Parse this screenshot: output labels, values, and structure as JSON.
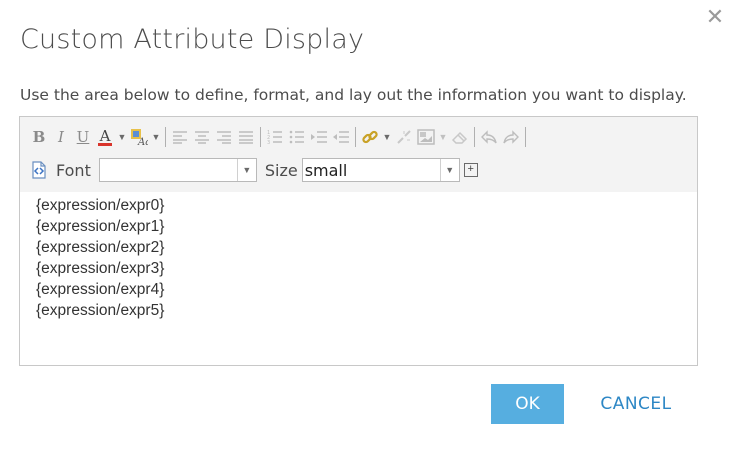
{
  "dialog": {
    "title": "Custom Attribute Display",
    "close_glyph": "✕",
    "instructions": "Use the area below to define, format, and lay out the information you want to display."
  },
  "toolbar": {
    "bold": "B",
    "italic": "I",
    "underline": "U",
    "font_color_glyph": "A",
    "font_label": "Font",
    "font_value": "",
    "size_label": "Size",
    "size_value": "small",
    "expand_glyph": "+",
    "icons": [
      "bold-icon",
      "italic-icon",
      "underline-icon",
      "font-color-icon",
      "highlight-color-icon",
      "align-left-icon",
      "align-center-icon",
      "align-right-icon",
      "align-justify-icon",
      "ordered-list-icon",
      "unordered-list-icon",
      "indent-icon",
      "outdent-icon",
      "link-icon",
      "unlink-icon",
      "insert-image-icon",
      "eraser-icon",
      "undo-icon",
      "redo-icon",
      "html-source-icon"
    ]
  },
  "editor": {
    "lines": [
      "{expression/expr0}",
      "{expression/expr1}",
      "{expression/expr2}",
      "{expression/expr3}",
      "{expression/expr4}",
      "{expression/expr5}"
    ]
  },
  "buttons": {
    "ok": "OK",
    "cancel": "CANCEL"
  },
  "colors": {
    "ok_bg": "#56aee0",
    "cancel_text": "#2d87c5",
    "font_color_underline": "#d9342b"
  }
}
